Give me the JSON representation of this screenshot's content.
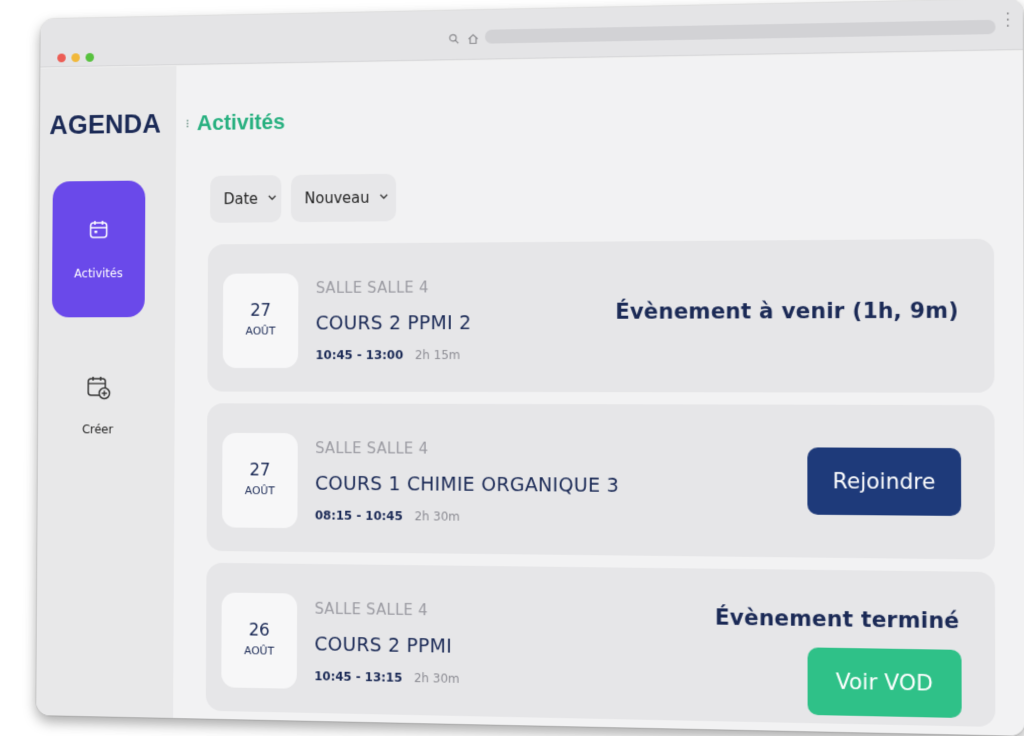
{
  "app": {
    "logo": "AGENDA"
  },
  "header": {
    "title": "Activités"
  },
  "sidebar": {
    "items": [
      {
        "label": "Activités",
        "icon": "calendar-icon",
        "active": true
      },
      {
        "label": "Créer",
        "icon": "calendar-add-icon",
        "active": false
      }
    ]
  },
  "filters": {
    "date": "Date",
    "new": "Nouveau"
  },
  "events": [
    {
      "day": "27",
      "month": "AOÛT",
      "room": "SALLE SALLE 4",
      "course": "COURS 2 PPMI 2",
      "time": "10:45 - 13:00",
      "duration": "2h 15m",
      "status": "Évènement à venir (1h, 9m)"
    },
    {
      "day": "27",
      "month": "AOÛT",
      "room": "SALLE SALLE 4",
      "course": "COURS 1 CHIMIE ORGANIQUE 3",
      "time": "08:15 - 10:45",
      "duration": "2h 30m",
      "action": "Rejoindre"
    },
    {
      "day": "26",
      "month": "AOÛT",
      "room": "SALLE SALLE 4",
      "course": "COURS 2 PPMI",
      "time": "10:45 - 13:15",
      "duration": "2h 30m",
      "status": "Évènement terminé",
      "action": "Voir VOD"
    }
  ],
  "colors": {
    "accent": "#6a49ea",
    "primary": "#1e3a7a",
    "success": "#2fc188",
    "brand_text": "#1b2a56",
    "title_green": "#27b07f"
  }
}
